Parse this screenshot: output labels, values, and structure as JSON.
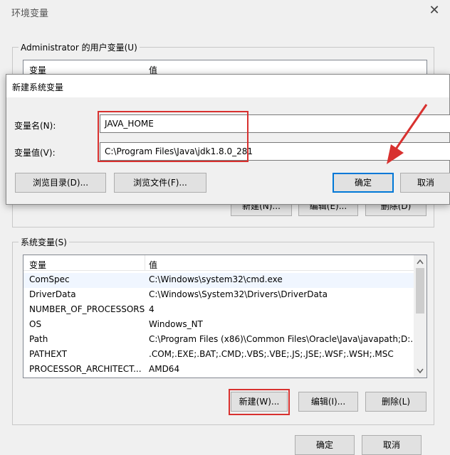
{
  "env_window": {
    "title": "环境变量",
    "close_glyph": "✕",
    "user_group": {
      "label": "Administrator 的用户变量(U)",
      "col_var": "变量",
      "col_val": "值",
      "buttons": {
        "new": "新建(N)...",
        "edit": "编辑(E)...",
        "delete": "删除(D)"
      }
    },
    "sys_group": {
      "label": "系统变量(S)",
      "col_var": "变量",
      "col_val": "值",
      "rows": [
        {
          "name": "ComSpec",
          "value": "C:\\Windows\\system32\\cmd.exe"
        },
        {
          "name": "DriverData",
          "value": "C:\\Windows\\System32\\Drivers\\DriverData"
        },
        {
          "name": "NUMBER_OF_PROCESSORS",
          "value": "4"
        },
        {
          "name": "OS",
          "value": "Windows_NT"
        },
        {
          "name": "Path",
          "value": "C:\\Program Files (x86)\\Common Files\\Oracle\\Java\\javapath;D:..."
        },
        {
          "name": "PATHEXT",
          "value": ".COM;.EXE;.BAT;.CMD;.VBS;.VBE;.JS;.JSE;.WSF;.WSH;.MSC"
        },
        {
          "name": "PROCESSOR_ARCHITECT...",
          "value": "AMD64"
        }
      ],
      "buttons": {
        "new": "新建(W)...",
        "edit": "编辑(I)...",
        "delete": "删除(L)"
      }
    },
    "footer": {
      "ok": "确定",
      "cancel": "取消"
    }
  },
  "dialog": {
    "title": "新建系统变量",
    "name_label": "变量名(N):",
    "name_value": "JAVA_HOME",
    "value_label": "变量值(V):",
    "value_value": "C:\\Program Files\\Java\\jdk1.8.0_281",
    "browse_dir": "浏览目录(D)...",
    "browse_file": "浏览文件(F)...",
    "ok": "确定",
    "cancel": "取消"
  },
  "colors": {
    "highlight": "#d8312f",
    "selected_row": "#f0f6ff"
  }
}
